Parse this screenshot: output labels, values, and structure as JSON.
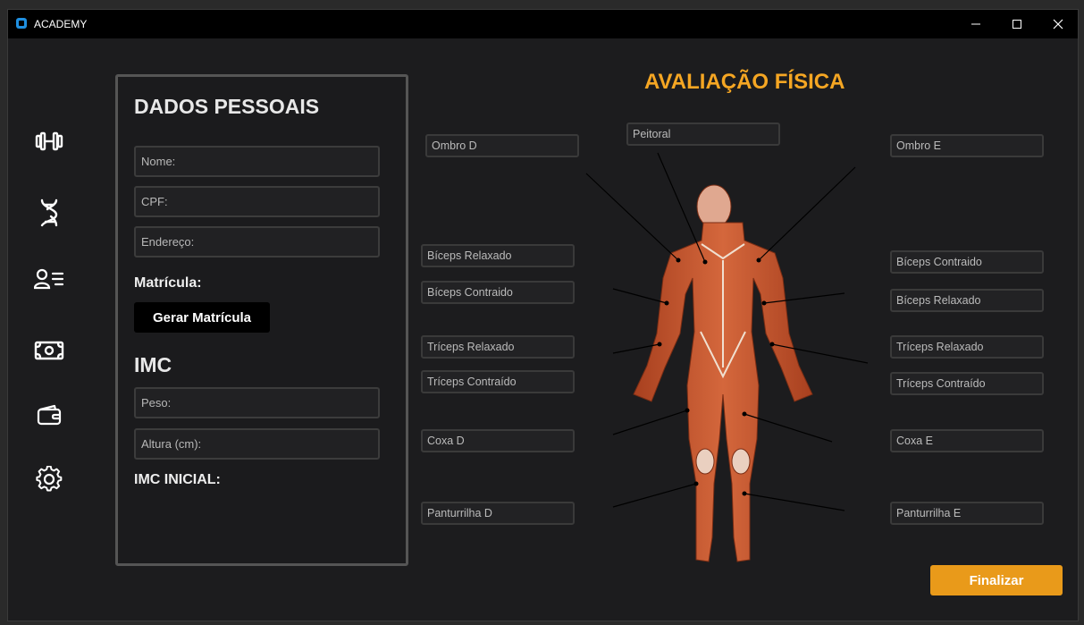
{
  "window": {
    "title": "ACADEMY"
  },
  "sidebar": {
    "items": [
      {
        "icon": "dumbbell-icon"
      },
      {
        "icon": "dna-icon"
      },
      {
        "icon": "user-list-icon"
      },
      {
        "icon": "money-icon"
      },
      {
        "icon": "wallet-icon"
      },
      {
        "icon": "gear-icon"
      }
    ]
  },
  "personal": {
    "title": "DADOS PESSOAIS",
    "name_placeholder": "Nome:",
    "cpf_placeholder": "CPF:",
    "address_placeholder": "Endereço:",
    "matricula_label": "Matrícula:",
    "generate_button": "Gerar Matrícula"
  },
  "imc": {
    "title": "IMC",
    "weight_placeholder": "Peso:",
    "height_placeholder": "Altura (cm):",
    "initial_label": "IMC INICIAL:"
  },
  "assessment": {
    "title": "AVALIAÇÃO FÍSICA",
    "peitoral": "Peitoral",
    "ombro_d": "Ombro D",
    "ombro_e": "Ombro E",
    "biceps_relaxado_d": "Bíceps Relaxado",
    "biceps_contraido_d": "Bíceps Contraido",
    "triceps_relaxado_d": "Tríceps Relaxado",
    "triceps_contraido_d": "Tríceps Contraído",
    "coxa_d": "Coxa D",
    "panturrilha_d": "Panturrilha D",
    "biceps_contraido_e": "Bíceps Contraido",
    "biceps_relaxado_e": "Bíceps Relaxado",
    "triceps_relaxado_e": "Tríceps Relaxado",
    "triceps_contraido_e": "Tríceps Contraído",
    "coxa_e": "Coxa E",
    "panturrilha_e": "Panturrilha E"
  },
  "actions": {
    "finish": "Finalizar"
  },
  "colors": {
    "accent": "#f5a623",
    "button": "#e99a1a",
    "background": "#1c1c1e",
    "muscle": "#c9552f"
  }
}
